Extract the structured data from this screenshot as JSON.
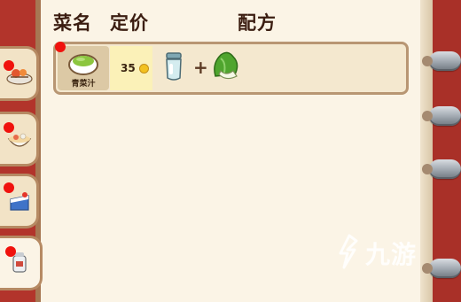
{
  "header": {
    "name_label": "菜名",
    "price_label": "定价",
    "recipe_label": "配方"
  },
  "dishes": [
    {
      "name": "青菜汁",
      "price": "35",
      "currency_icon": "gold-coin-icon",
      "ingredients": [
        "juicer-icon",
        "bok-choy-icon"
      ],
      "new_badge": true
    }
  ],
  "tabs": [
    {
      "icon": "seafood-platter-icon",
      "badge": true,
      "active": false
    },
    {
      "icon": "noodle-bowl-icon",
      "badge": true,
      "active": false
    },
    {
      "icon": "cake-slice-icon",
      "badge": true,
      "active": false
    },
    {
      "icon": "drink-cup-icon",
      "badge": true,
      "active": true
    }
  ],
  "watermark": {
    "text": "九游",
    "icon": "9game-logo-icon"
  },
  "colors": {
    "cover": "#a93028",
    "paper": "#fbf4e6",
    "row_border": "#b89673",
    "badge_red": "#f0120d",
    "coin": "#f2c11f"
  }
}
